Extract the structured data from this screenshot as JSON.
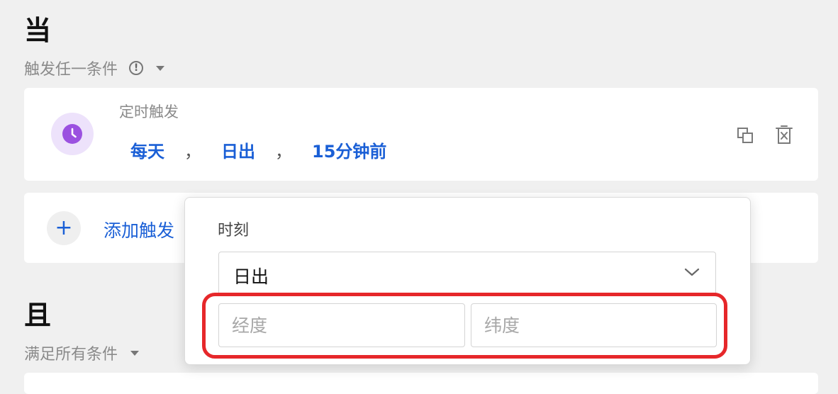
{
  "when_section": {
    "title": "当",
    "mode_label": "触发任一条件"
  },
  "trigger_card": {
    "type_label": "定时触发",
    "frequency": "每天",
    "time_point": "日出",
    "offset": "15分钟前",
    "separator": "，",
    "icons": [
      "clock-icon",
      "copy-icon",
      "delete-icon"
    ],
    "accent_color": "#9b51e0"
  },
  "add_trigger": {
    "label": "添加触发"
  },
  "and_section": {
    "title": "且",
    "mode_label": "满足所有条件"
  },
  "time_popup": {
    "label": "时刻",
    "selected_time": "日出",
    "longitude_placeholder": "经度",
    "latitude_placeholder": "纬度"
  },
  "colors": {
    "link_blue": "#1a5fd6",
    "highlight_red": "#e6272a",
    "background": "#f0f0f0"
  }
}
